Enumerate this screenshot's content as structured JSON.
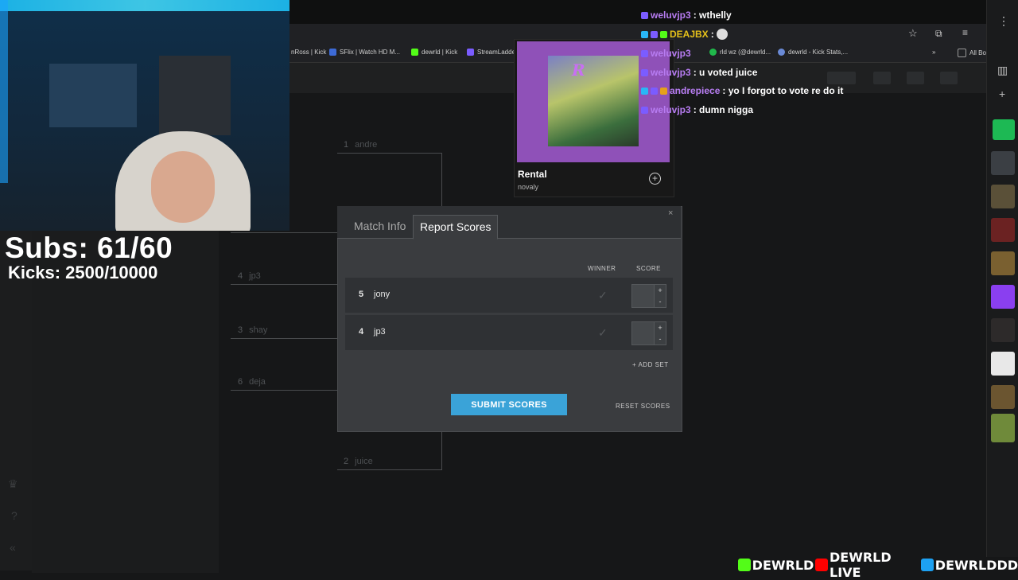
{
  "overlay": {
    "subs": "Subs: 61/60",
    "kicks": "Kicks: 2500/10000"
  },
  "bookmarks": [
    {
      "label": "nRoss | Kick",
      "color": "#444"
    },
    {
      "label": "SFlix | Watch HD M...",
      "color": "#3d6ad6"
    },
    {
      "label": "dewrld | Kick",
      "color": "#53fc18"
    },
    {
      "label": "StreamLadde",
      "color": "#7a5cff"
    },
    {
      "label": "rld wz (@dewrld...",
      "color": "#20b84b"
    },
    {
      "label": "dewrld - Kick Stats,...",
      "color": "#6a8ad6"
    },
    {
      "label": "All Bo",
      "color": "#999"
    }
  ],
  "bracket": [
    {
      "seed": "1",
      "name": "andre"
    },
    {
      "seed": "4",
      "name": "jp3"
    },
    {
      "seed": "3",
      "name": "shay"
    },
    {
      "seed": "6",
      "name": "deja"
    },
    {
      "seed": "2",
      "name": "juice"
    }
  ],
  "spotify": {
    "title": "Rental",
    "artist": "novaly",
    "add_icon": "plus-circle-icon"
  },
  "modal": {
    "tabs": [
      "Match Info",
      "Report Scores"
    ],
    "active_tab": "Report Scores",
    "col_winner": "WINNER",
    "col_score": "SCORE",
    "participants": [
      {
        "seed": "5",
        "name": "jony",
        "score": ""
      },
      {
        "seed": "4",
        "name": "jp3",
        "score": ""
      }
    ],
    "stepper_plus": "+",
    "stepper_minus": "-",
    "add_set": "+ ADD SET",
    "submit": "SUBMIT SCORES",
    "reset": "RESET SCORES",
    "close": "×"
  },
  "chat": [
    {
      "user": "weluvjp3",
      "msg": ": wthelly",
      "badge_color": "#7b5cff"
    },
    {
      "user": "DEAJBX",
      "msg": ":",
      "badge_color": "#29b6f6",
      "user_color": "#e6c11a"
    },
    {
      "user": "weluvjp3",
      "msg": "",
      "badge_color": "#7b5cff"
    },
    {
      "user": "weluvjp3",
      "msg": ": u voted juice",
      "badge_color": "#7b5cff"
    },
    {
      "user": "andrepiece",
      "msg": ": yo I forgot to vote re do it",
      "badge_color": "#29b6f6"
    },
    {
      "user": "weluvjp3",
      "msg": ": dumn nigga",
      "badge_color": "#7b5cff"
    }
  ],
  "social": [
    "DEWRLD",
    "DEWRLD LIVE",
    "DEWRLDDD"
  ],
  "colors": {
    "accent": "#3aa3d8",
    "kick_green": "#53fc18",
    "chat_user": "#b77cf2"
  }
}
